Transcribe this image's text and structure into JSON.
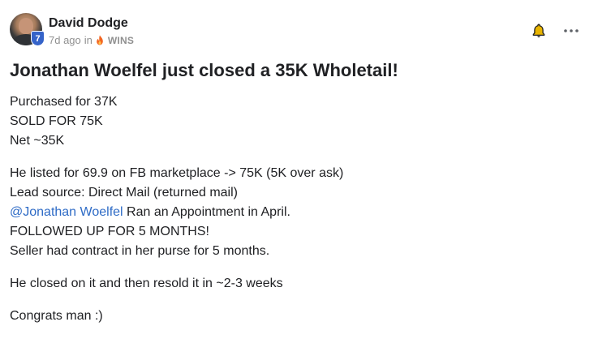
{
  "post": {
    "author": {
      "name": "David Dodge",
      "level": "7",
      "avatar_icon": "user-avatar-photo"
    },
    "meta": {
      "time_ago": "7d ago",
      "in_word": "in",
      "category_icon": "flame-icon",
      "category": "WINS"
    },
    "actions": {
      "bell_icon": "bell-icon",
      "more_icon": "more-horizontal-icon",
      "bell_color": "#e8b400"
    },
    "title": "Jonathan Woelfel just closed a 35K Wholetail!",
    "paragraphs": [
      [
        "Purchased for 37K",
        "SOLD FOR 75K",
        "Net ~35K"
      ],
      [
        "He listed for 69.9 on FB marketplace -> 75K (5K over ask)",
        "Lead source: Direct Mail (returned mail)",
        "FOLLOWED UP FOR 5 MONTHS!",
        "Seller had contract in her purse for 5 months."
      ],
      [
        "He closed on it and then resold it in ~2-3 weeks"
      ],
      [
        "Congrats man :)"
      ]
    ],
    "mention_line": {
      "mention": "@Jonathan Woelfel",
      "rest": " Ran an Appointment in April."
    },
    "colors": {
      "mention": "#2e6bc6",
      "level_badge": "#3563c9",
      "flame": "#f26522"
    }
  }
}
